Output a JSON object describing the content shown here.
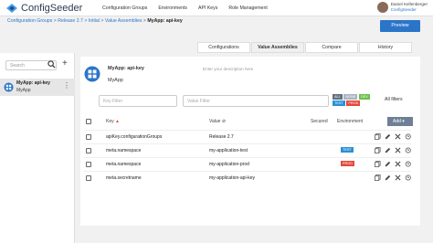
{
  "app": {
    "name": "ConfigSeeder"
  },
  "nav": [
    "Configuration Groups",
    "Environments",
    "API Keys",
    "Role Management"
  ],
  "user": {
    "name": "Daniel Kellenberger",
    "org": "ConfigSeeder"
  },
  "breadcrumb": {
    "items": [
      "Configuration Groups",
      "Release 2.7",
      "Initial",
      "Value Assemblies"
    ],
    "current": "MyApp: api-key"
  },
  "preview_label": "Preview",
  "tabs": [
    "Configurations",
    "Value Assemblies",
    "Compare",
    "History"
  ],
  "active_tab": "Value Assemblies",
  "sidebar": {
    "search_placeholder": "Search",
    "add_label": "+",
    "item": {
      "title": "MyApp: api-key",
      "subtitle": "MyApp"
    }
  },
  "assembly": {
    "title": "MyApp: api-key",
    "description_placeholder": "Enter your description here",
    "name": "MyApp"
  },
  "filters": {
    "key_placeholder": "Key Filter",
    "value_placeholder": "Value Filter",
    "env_badges": [
      {
        "label": "ALL",
        "color": "#607080"
      },
      {
        "label": "NONE",
        "color": "#aab4bf"
      },
      {
        "label": "DEV",
        "color": "#6cc04a"
      },
      {
        "label": "TEST",
        "color": "#2b8fd6"
      },
      {
        "label": "PROD",
        "color": "#e24a3b"
      }
    ],
    "all_filters_label": "All filters"
  },
  "table": {
    "headers": {
      "key": "Key",
      "value": "Value",
      "secured": "Secured",
      "environment": "Environment"
    },
    "add_label": "Add",
    "rows": [
      {
        "key": "apiKey.configurationGroups",
        "value": "Release 2.7",
        "env": ""
      },
      {
        "key": "meta.namespace",
        "value": "my-application-test",
        "env": "TEST"
      },
      {
        "key": "meta.namespace",
        "value": "my-application-prod",
        "env": "PROD"
      },
      {
        "key": "meta.secretname",
        "value": "my-application-api-key",
        "env": ""
      }
    ]
  },
  "colors": {
    "primary": "#2b75c9",
    "test": "#2b8fd6",
    "prod": "#e24a3b",
    "add_button": "#6e8095"
  }
}
